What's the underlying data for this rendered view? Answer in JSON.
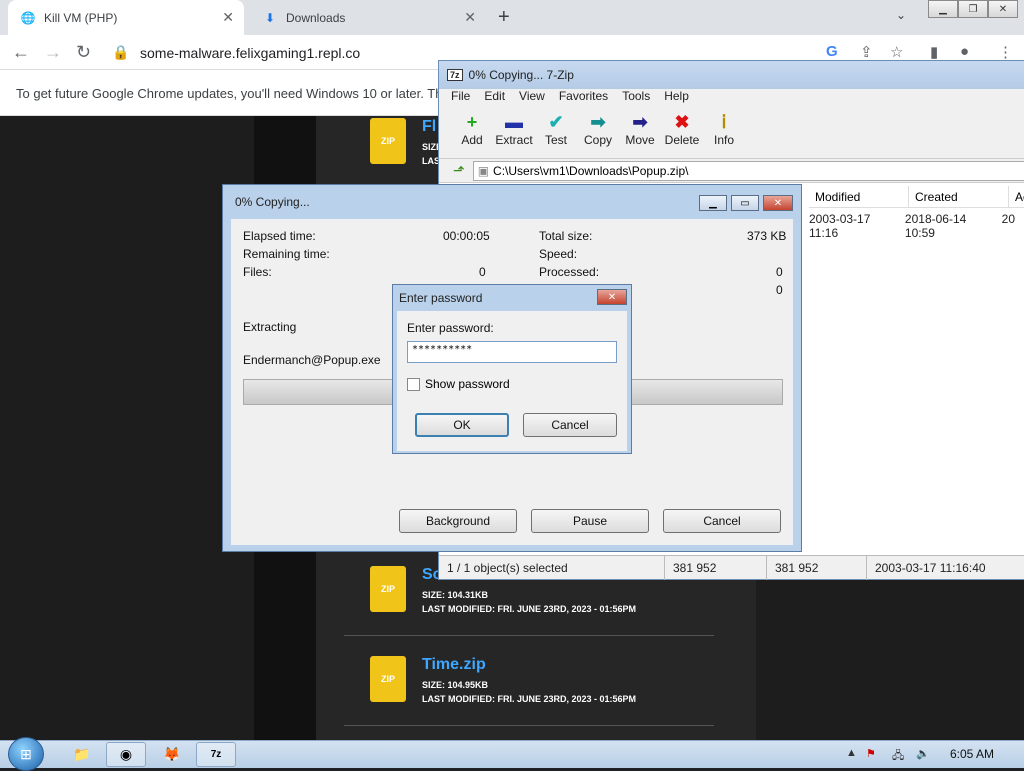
{
  "browser": {
    "tabs": [
      {
        "title": "Kill VM (PHP)",
        "active": true
      },
      {
        "title": "Downloads",
        "active": false
      }
    ],
    "url": "some-malware.felixgaming1.repl.co",
    "infobar": "To get future Google Chrome updates, you'll need Windows 10 or later. Th"
  },
  "page": {
    "files": [
      {
        "name": "Fl",
        "meta1": "SIZE",
        "meta2": "LAS",
        "icon": "ZIP"
      },
      {
        "name": "So",
        "meta1": "SIZE: 104.31KB",
        "meta2": "LAST MODIFIED: FRI. JUNE 23RD, 2023 - 01:56PM",
        "icon": "ZIP"
      },
      {
        "name": "Time.zip",
        "meta1": "SIZE: 104.95KB",
        "meta2": "LAST MODIFIED: FRI. JUNE 23RD, 2023 - 01:56PM",
        "icon": "ZIP"
      }
    ]
  },
  "zip": {
    "title": "0% Copying... 7-Zip",
    "menu": [
      "File",
      "Edit",
      "View",
      "Favorites",
      "Tools",
      "Help"
    ],
    "toolbar": [
      {
        "label": "Add",
        "icon": "+",
        "color": "#22aa22"
      },
      {
        "label": "Extract",
        "icon": "▬",
        "color": "#2233aa"
      },
      {
        "label": "Test",
        "icon": "✔",
        "color": "#1ab0b0"
      },
      {
        "label": "Copy",
        "icon": "➡",
        "color": "#138f8f"
      },
      {
        "label": "Move",
        "icon": "➡",
        "color": "#22228a"
      },
      {
        "label": "Delete",
        "icon": "✖",
        "color": "#dd1111"
      },
      {
        "label": "Info",
        "icon": "ⅰ",
        "color": "#b38f00"
      }
    ],
    "path": "C:\\Users\\vm1\\Downloads\\Popup.zip\\",
    "columns": [
      "Modified",
      "Created",
      "Ac"
    ],
    "row": [
      "2003-03-17 11:16",
      "2018-06-14 10:59",
      "20"
    ],
    "status": [
      "1 / 1 object(s) selected",
      "381 952",
      "381 952",
      "2003-03-17 11:16:40"
    ]
  },
  "copy": {
    "title": "0% Copying...",
    "elapsed_label": "Elapsed time:",
    "elapsed": "00:00:05",
    "remaining_label": "Remaining time:",
    "files_label": "Files:",
    "files": "0",
    "total_label": "Total size:",
    "total": "373 KB",
    "speed_label": "Speed:",
    "processed_label": "Processed:",
    "processed": "0",
    "extra": "0",
    "action": "Extracting",
    "current_file": "Endermanch@Popup.exe",
    "buttons": {
      "background": "Background",
      "pause": "Pause",
      "cancel": "Cancel"
    }
  },
  "password": {
    "title": "Enter password",
    "label": "Enter password:",
    "value": "**********",
    "show_label": "Show password",
    "ok": "OK",
    "cancel": "Cancel"
  },
  "taskbar": {
    "clock": "6:05 AM"
  }
}
